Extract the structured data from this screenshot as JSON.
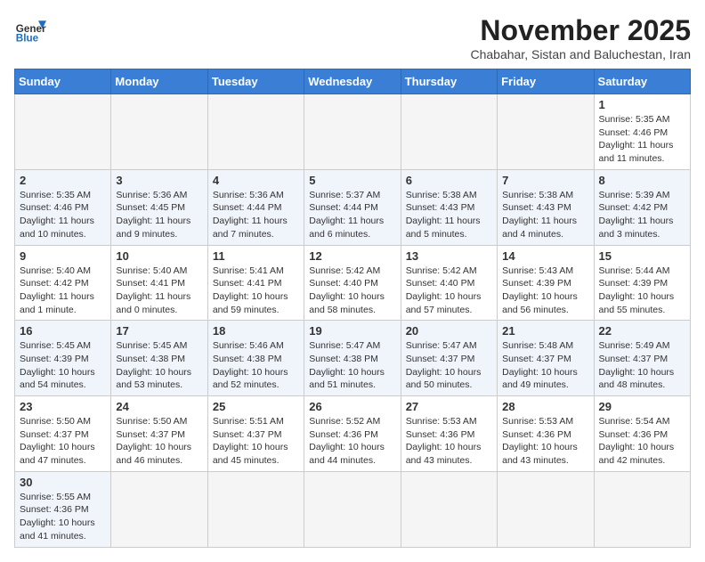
{
  "header": {
    "logo_general": "General",
    "logo_blue": "Blue",
    "month_title": "November 2025",
    "subtitle": "Chabahar, Sistan and Baluchestan, Iran"
  },
  "weekdays": [
    "Sunday",
    "Monday",
    "Tuesday",
    "Wednesday",
    "Thursday",
    "Friday",
    "Saturday"
  ],
  "weeks": [
    [
      {
        "day": "",
        "info": ""
      },
      {
        "day": "",
        "info": ""
      },
      {
        "day": "",
        "info": ""
      },
      {
        "day": "",
        "info": ""
      },
      {
        "day": "",
        "info": ""
      },
      {
        "day": "",
        "info": ""
      },
      {
        "day": "1",
        "info": "Sunrise: 5:35 AM\nSunset: 4:46 PM\nDaylight: 11 hours and 11 minutes."
      }
    ],
    [
      {
        "day": "2",
        "info": "Sunrise: 5:35 AM\nSunset: 4:46 PM\nDaylight: 11 hours and 10 minutes."
      },
      {
        "day": "3",
        "info": "Sunrise: 5:36 AM\nSunset: 4:45 PM\nDaylight: 11 hours and 9 minutes."
      },
      {
        "day": "4",
        "info": "Sunrise: 5:36 AM\nSunset: 4:44 PM\nDaylight: 11 hours and 7 minutes."
      },
      {
        "day": "5",
        "info": "Sunrise: 5:37 AM\nSunset: 4:44 PM\nDaylight: 11 hours and 6 minutes."
      },
      {
        "day": "6",
        "info": "Sunrise: 5:38 AM\nSunset: 4:43 PM\nDaylight: 11 hours and 5 minutes."
      },
      {
        "day": "7",
        "info": "Sunrise: 5:38 AM\nSunset: 4:43 PM\nDaylight: 11 hours and 4 minutes."
      },
      {
        "day": "8",
        "info": "Sunrise: 5:39 AM\nSunset: 4:42 PM\nDaylight: 11 hours and 3 minutes."
      }
    ],
    [
      {
        "day": "9",
        "info": "Sunrise: 5:40 AM\nSunset: 4:42 PM\nDaylight: 11 hours and 1 minute."
      },
      {
        "day": "10",
        "info": "Sunrise: 5:40 AM\nSunset: 4:41 PM\nDaylight: 11 hours and 0 minutes."
      },
      {
        "day": "11",
        "info": "Sunrise: 5:41 AM\nSunset: 4:41 PM\nDaylight: 10 hours and 59 minutes."
      },
      {
        "day": "12",
        "info": "Sunrise: 5:42 AM\nSunset: 4:40 PM\nDaylight: 10 hours and 58 minutes."
      },
      {
        "day": "13",
        "info": "Sunrise: 5:42 AM\nSunset: 4:40 PM\nDaylight: 10 hours and 57 minutes."
      },
      {
        "day": "14",
        "info": "Sunrise: 5:43 AM\nSunset: 4:39 PM\nDaylight: 10 hours and 56 minutes."
      },
      {
        "day": "15",
        "info": "Sunrise: 5:44 AM\nSunset: 4:39 PM\nDaylight: 10 hours and 55 minutes."
      }
    ],
    [
      {
        "day": "16",
        "info": "Sunrise: 5:45 AM\nSunset: 4:39 PM\nDaylight: 10 hours and 54 minutes."
      },
      {
        "day": "17",
        "info": "Sunrise: 5:45 AM\nSunset: 4:38 PM\nDaylight: 10 hours and 53 minutes."
      },
      {
        "day": "18",
        "info": "Sunrise: 5:46 AM\nSunset: 4:38 PM\nDaylight: 10 hours and 52 minutes."
      },
      {
        "day": "19",
        "info": "Sunrise: 5:47 AM\nSunset: 4:38 PM\nDaylight: 10 hours and 51 minutes."
      },
      {
        "day": "20",
        "info": "Sunrise: 5:47 AM\nSunset: 4:37 PM\nDaylight: 10 hours and 50 minutes."
      },
      {
        "day": "21",
        "info": "Sunrise: 5:48 AM\nSunset: 4:37 PM\nDaylight: 10 hours and 49 minutes."
      },
      {
        "day": "22",
        "info": "Sunrise: 5:49 AM\nSunset: 4:37 PM\nDaylight: 10 hours and 48 minutes."
      }
    ],
    [
      {
        "day": "23",
        "info": "Sunrise: 5:50 AM\nSunset: 4:37 PM\nDaylight: 10 hours and 47 minutes."
      },
      {
        "day": "24",
        "info": "Sunrise: 5:50 AM\nSunset: 4:37 PM\nDaylight: 10 hours and 46 minutes."
      },
      {
        "day": "25",
        "info": "Sunrise: 5:51 AM\nSunset: 4:37 PM\nDaylight: 10 hours and 45 minutes."
      },
      {
        "day": "26",
        "info": "Sunrise: 5:52 AM\nSunset: 4:36 PM\nDaylight: 10 hours and 44 minutes."
      },
      {
        "day": "27",
        "info": "Sunrise: 5:53 AM\nSunset: 4:36 PM\nDaylight: 10 hours and 43 minutes."
      },
      {
        "day": "28",
        "info": "Sunrise: 5:53 AM\nSunset: 4:36 PM\nDaylight: 10 hours and 43 minutes."
      },
      {
        "day": "29",
        "info": "Sunrise: 5:54 AM\nSunset: 4:36 PM\nDaylight: 10 hours and 42 minutes."
      }
    ],
    [
      {
        "day": "30",
        "info": "Sunrise: 5:55 AM\nSunset: 4:36 PM\nDaylight: 10 hours and 41 minutes."
      },
      {
        "day": "",
        "info": ""
      },
      {
        "day": "",
        "info": ""
      },
      {
        "day": "",
        "info": ""
      },
      {
        "day": "",
        "info": ""
      },
      {
        "day": "",
        "info": ""
      },
      {
        "day": "",
        "info": ""
      }
    ]
  ]
}
